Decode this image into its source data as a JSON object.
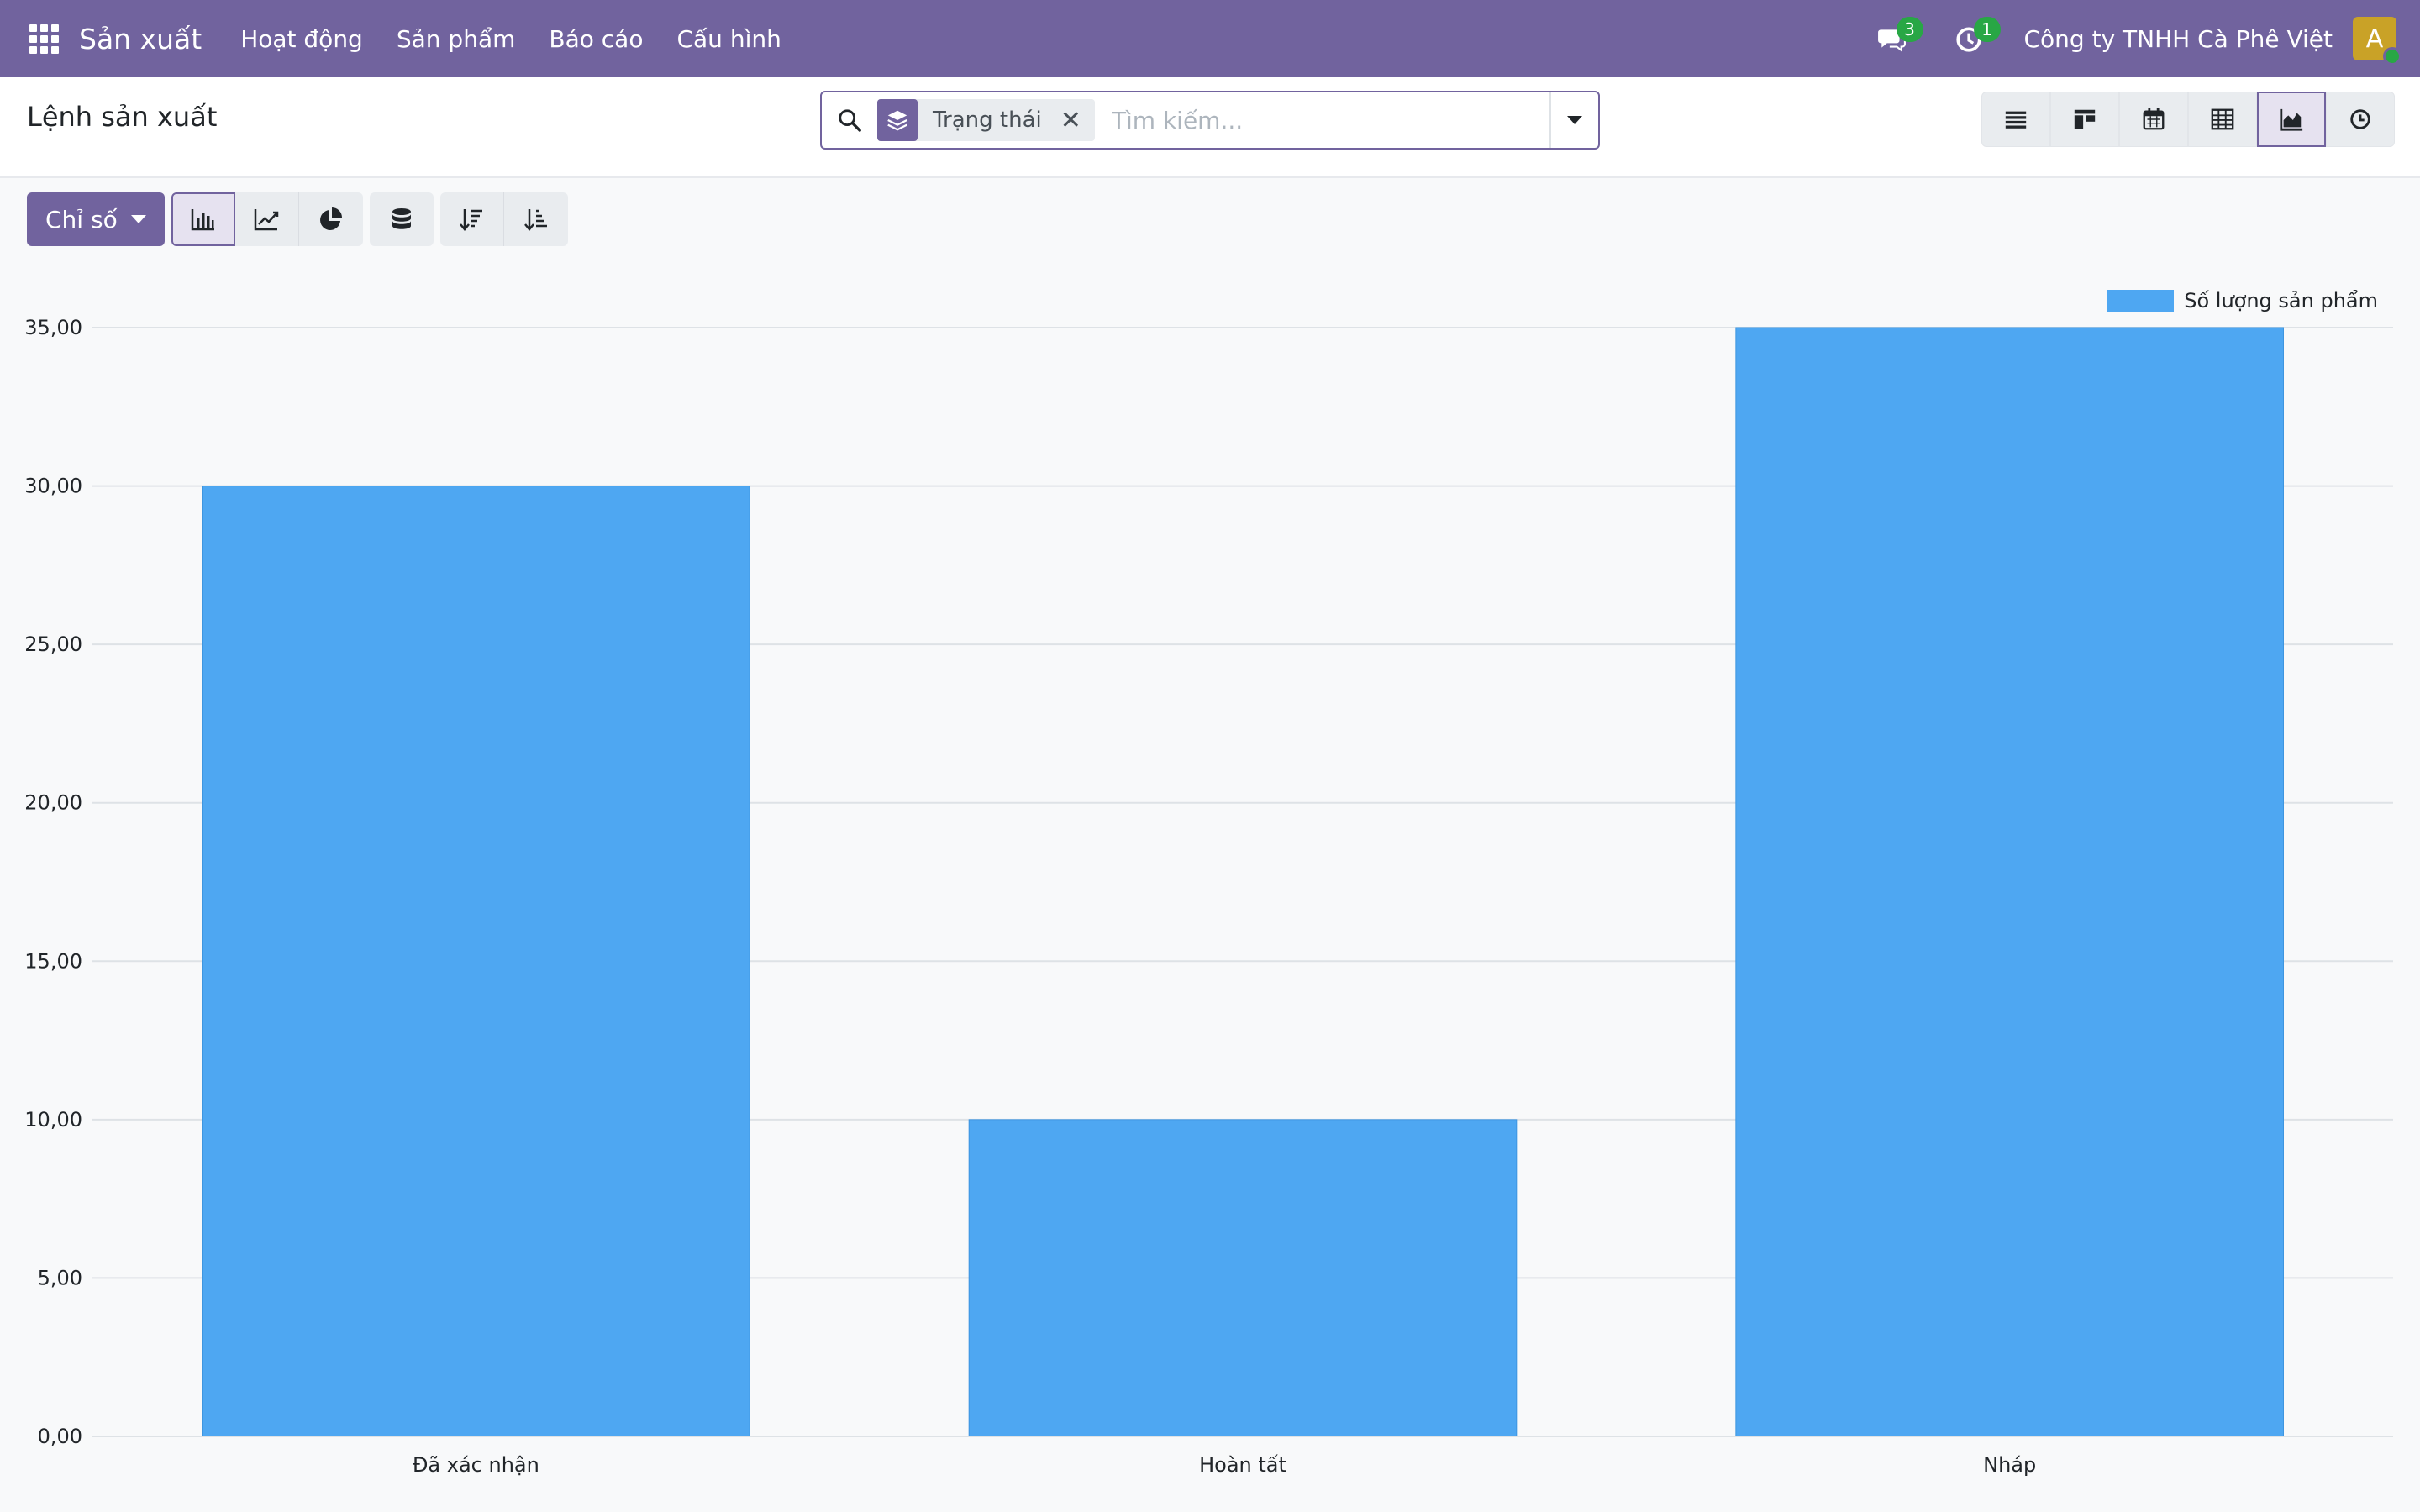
{
  "navbar": {
    "app_name": "Sản xuất",
    "menu": [
      "Hoạt động",
      "Sản phẩm",
      "Báo cáo",
      "Cấu hình"
    ],
    "messages_count": "3",
    "activities_count": "1",
    "company": "Công ty TNHH Cà Phê Việt",
    "avatar_initial": "A"
  },
  "control_panel": {
    "title": "Lệnh sản xuất",
    "facet_label": "Trạng thái",
    "search_placeholder": "Tìm kiếm...",
    "views": [
      "list-icon",
      "kanban-icon",
      "calendar-icon",
      "pivot-icon",
      "graph-icon",
      "activity-icon"
    ],
    "active_view": "graph-icon"
  },
  "toolbar": {
    "measures_label": "Chỉ số",
    "active_chart_mode": "bar"
  },
  "colors": {
    "brand": "#71639e",
    "bar": "#4ea7f2"
  },
  "chart_data": {
    "type": "bar",
    "categories": [
      "Đã xác nhận",
      "Hoàn tất",
      "Nháp"
    ],
    "series": [
      {
        "name": "Số lượng sản phẩm",
        "values": [
          30,
          10,
          35
        ],
        "color": "#4ea7f2"
      }
    ],
    "ylim": [
      0,
      35
    ],
    "y_ticks": [
      "0,00",
      "5,00",
      "10,00",
      "15,00",
      "20,00",
      "25,00",
      "30,00",
      "35,00"
    ],
    "y_tick_values": [
      0,
      5,
      10,
      15,
      20,
      25,
      30,
      35
    ],
    "grid": true,
    "legend_position": "top-right"
  }
}
